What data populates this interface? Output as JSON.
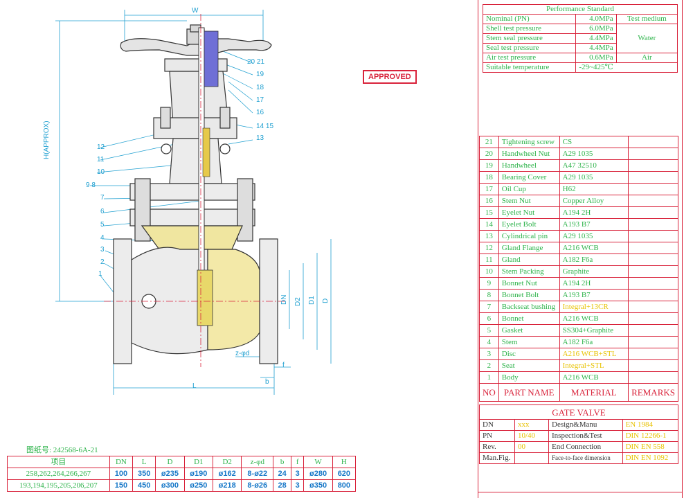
{
  "stamp": "APPROVED",
  "drawing_no": "图纸号: 242568-6A-21",
  "performance": {
    "title": "Performance Standard",
    "rows": [
      {
        "label": "Nominal  (PN)",
        "value": "4.0MPa",
        "medium": "Test medium"
      },
      {
        "label": "Shell test pressure",
        "value": "6.0MPa",
        "medium": ""
      },
      {
        "label": "Stem seal pressure",
        "value": "4.4MPa",
        "medium": "Water"
      },
      {
        "label": "Seal test pressure",
        "value": "4.4MPa",
        "medium": ""
      },
      {
        "label": "Air test pressure",
        "value": "0.6MPa",
        "medium": "Air"
      },
      {
        "label": "Suitable temperature",
        "value": "-29~425℃",
        "medium": ""
      }
    ]
  },
  "parts": [
    {
      "no": "21",
      "name": "Tightening screw",
      "material": "CS",
      "mcolor": "g"
    },
    {
      "no": "20",
      "name": "Handwheel Nut",
      "material": "A29 1035",
      "mcolor": "g"
    },
    {
      "no": "19",
      "name": "Handwheel",
      "material": "A47 32510",
      "mcolor": "g"
    },
    {
      "no": "18",
      "name": "Bearing Cover",
      "material": "A29 1035",
      "mcolor": "g"
    },
    {
      "no": "17",
      "name": "Oil Cup",
      "material": "H62",
      "mcolor": "g"
    },
    {
      "no": "16",
      "name": "Stem Nut",
      "material": "Copper Alloy",
      "mcolor": "g"
    },
    {
      "no": "15",
      "name": "Eyelet Nut",
      "material": "A194 2H",
      "mcolor": "g"
    },
    {
      "no": "14",
      "name": "Eyelet Bolt",
      "material": "A193 B7",
      "mcolor": "g"
    },
    {
      "no": "13",
      "name": "Cylindrical pin",
      "material": "A29 1035",
      "mcolor": "g"
    },
    {
      "no": "12",
      "name": "Gland Flange",
      "material": "A216 WCB",
      "mcolor": "g"
    },
    {
      "no": "11",
      "name": "Gland",
      "material": "A182 F6a",
      "mcolor": "g"
    },
    {
      "no": "10",
      "name": "Stem Packing",
      "material": "Graphite",
      "mcolor": "g"
    },
    {
      "no": "9",
      "name": "Bonnet Nut",
      "material": "A194 2H",
      "mcolor": "g"
    },
    {
      "no": "8",
      "name": "Bonnet Bolt",
      "material": "A193 B7",
      "mcolor": "g"
    },
    {
      "no": "7",
      "name": "Backseat bushing",
      "material": "Integral+13CR",
      "mcolor": "y"
    },
    {
      "no": "6",
      "name": "Bonnet",
      "material": "A216 WCB",
      "mcolor": "g"
    },
    {
      "no": "5",
      "name": "Gasket",
      "material": "SS304+Graphite",
      "mcolor": "g"
    },
    {
      "no": "4",
      "name": "Stem",
      "material": "A182 F6a",
      "mcolor": "g"
    },
    {
      "no": "3",
      "name": "Disc",
      "material": "A216 WCB+STL",
      "mcolor": "y"
    },
    {
      "no": "2",
      "name": "Seat",
      "material": "Integral+STL",
      "mcolor": "y"
    },
    {
      "no": "1",
      "name": "Body",
      "material": "A216 WCB",
      "mcolor": "g"
    }
  ],
  "parts_header": {
    "no": "NO",
    "name": "PART NAME",
    "material": "MATERIAL",
    "remarks": "REMARKS"
  },
  "title_block": {
    "title": "GATE VALVE",
    "rows": [
      {
        "k": "DN",
        "v": "xxx",
        "k2": "Design&Manu",
        "v2": "EN 1984"
      },
      {
        "k": "PN",
        "v": "10/40",
        "k2": "Inspection&Test",
        "v2": "DIN 12266-1"
      },
      {
        "k": "Rev.",
        "v": "00",
        "k2": "End Connection",
        "v2": "DIN EN 558"
      },
      {
        "k": "Man.Fig.",
        "v": "",
        "k2": "Face-to-face dimension",
        "v2": "DIN EN 1092"
      }
    ]
  },
  "dims": {
    "headers": [
      "项目",
      "DN",
      "L",
      "D",
      "D1",
      "D2",
      "z-φd",
      "b",
      "f",
      "W",
      "H"
    ],
    "rows": [
      [
        "258,262,264,266,267",
        "100",
        "350",
        "ø235",
        "ø190",
        "ø162",
        "8-ø22",
        "24",
        "3",
        "ø280",
        "620"
      ],
      [
        "193,194,195,205,206,207",
        "150",
        "450",
        "ø300",
        "ø250",
        "ø218",
        "8-ø26",
        "28",
        "3",
        "ø350",
        "800"
      ]
    ]
  },
  "drawing": {
    "dim_labels": {
      "W": "W",
      "H": "H(APPROX)",
      "L": "L",
      "DN": "DN",
      "D2": "D2",
      "D1": "D1",
      "D": "D",
      "b": "b",
      "f": "f",
      "zd": "z-φd"
    },
    "callouts": [
      "1",
      "2",
      "3",
      "4",
      "5",
      "6",
      "7",
      "9  8",
      "10",
      "11",
      "12",
      "13",
      "14  15",
      "16",
      "17",
      "18",
      "19",
      "20  21"
    ]
  }
}
